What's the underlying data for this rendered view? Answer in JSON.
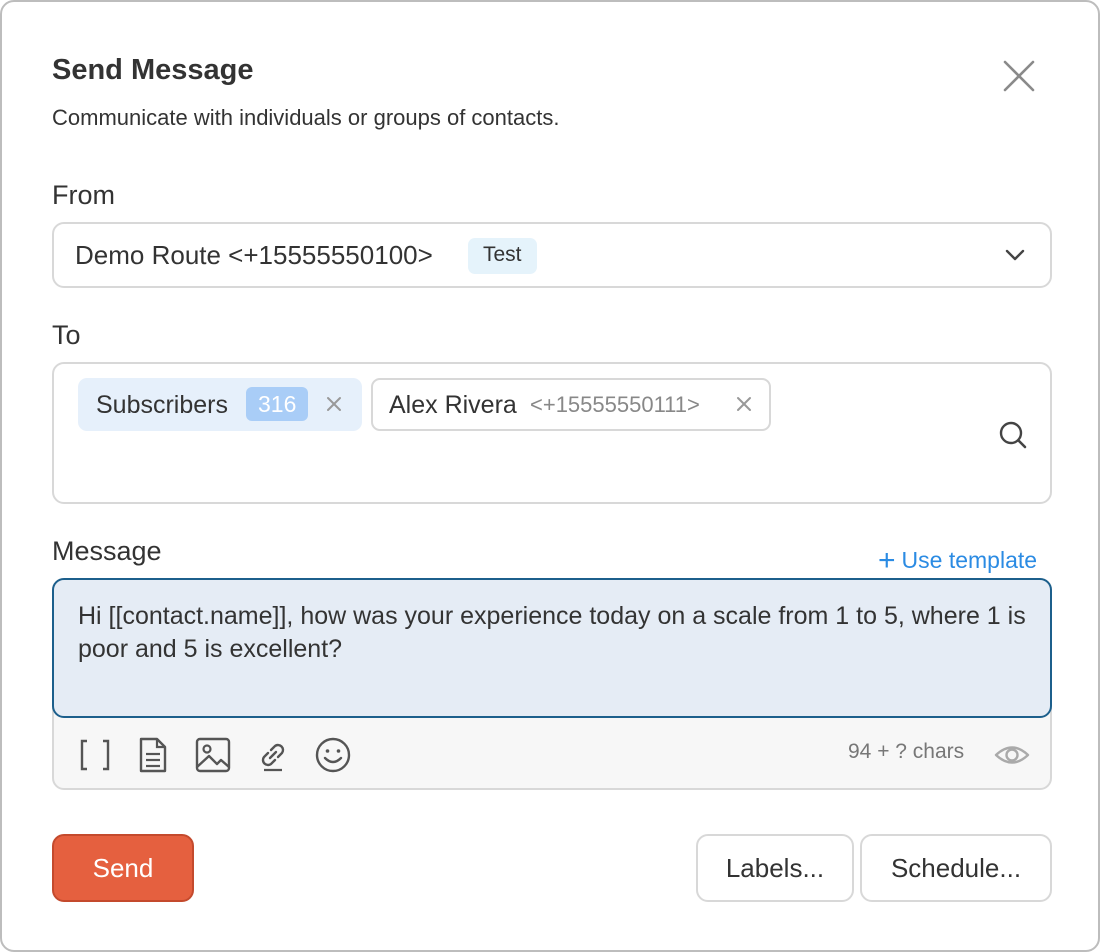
{
  "header": {
    "title": "Send Message",
    "subtitle": "Communicate with individuals or groups of contacts."
  },
  "from": {
    "label": "From",
    "value": "Demo Route <+15555550100>",
    "badge": "Test"
  },
  "to": {
    "label": "To",
    "recipients": [
      {
        "name": "Subscribers",
        "count": "316",
        "type": "group"
      },
      {
        "name": "Alex Rivera",
        "phone": "<+15555550111>",
        "type": "contact"
      }
    ],
    "remove_glyph": "×"
  },
  "message": {
    "label": "Message",
    "use_template_plus": "+",
    "use_template": "Use template",
    "text": "Hi [[contact.name]], how was your experience today on a scale from 1 to 5, where 1 is poor and 5 is excellent?",
    "char_count": "94 + ? chars",
    "toolbar_icons": [
      "variable-brackets-icon",
      "document-icon",
      "image-icon",
      "link-icon",
      "emoji-icon",
      "eye-icon"
    ]
  },
  "actions": {
    "send": "Send",
    "labels": "Labels...",
    "schedule": "Schedule..."
  },
  "colors": {
    "primary": "#e5603f",
    "link": "#2b8be3",
    "focus_border": "#1c5f8c",
    "badge_bg": "#a9cdf7",
    "chip_bg": "#e6f0fb"
  }
}
